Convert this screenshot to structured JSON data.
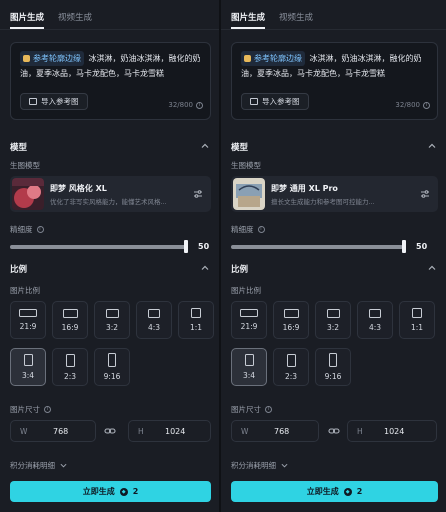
{
  "tabs": [
    "图片生成",
    "视频生成"
  ],
  "prompt": {
    "chip": "参考轮廓边缘",
    "text": "冰淇淋，奶油冰淇淋，融化的奶油，夏季冰品，马卡龙配色，马卡龙雪糕",
    "import_label": "导入参考图",
    "counter": "32/800"
  },
  "model_section": {
    "title": "模型",
    "sub_label": "生图模型"
  },
  "precision": {
    "label": "精细度",
    "value": 50,
    "max": 50
  },
  "ratio_section": {
    "title": "比例",
    "sub_label": "图片比例",
    "options": [
      "21:9",
      "16:9",
      "3:2",
      "4:3",
      "1:1",
      "3:4",
      "2:3",
      "9:16"
    ],
    "selected": "3:4"
  },
  "size": {
    "label": "图片尺寸",
    "w_prefix": "W",
    "width": "768",
    "h_prefix": "H",
    "height": "1024"
  },
  "cost_label": "积分消耗明细",
  "generate": {
    "label": "立即生成",
    "cost": "2"
  },
  "panels": [
    {
      "model_name": "即梦 风格化 XL",
      "model_desc": "优化了非写实风格能力，能懂艺术风格..."
    },
    {
      "model_name": "即梦 通用 XL Pro",
      "model_desc": "擅长文生成能力和参考图可控能力..."
    }
  ],
  "colors": {
    "accent": "#2fd3e3",
    "background": "#1a1d24"
  }
}
